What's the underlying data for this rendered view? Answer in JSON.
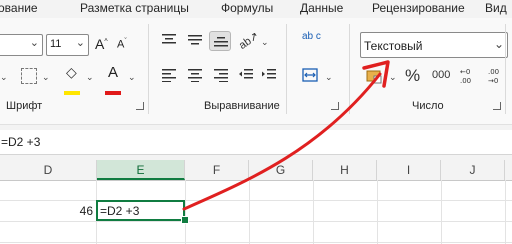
{
  "tabs": [
    "ование",
    "Разметка страницы",
    "Формулы",
    "Данные",
    "Рецензирование",
    "Вид"
  ],
  "ribbon": {
    "font_size": "11",
    "number_format": "Текстовый",
    "groups": {
      "font": "Шрифт",
      "alignment": "Выравнивание",
      "number": "Число"
    },
    "percent_symbol": "%",
    "comma_symbol": "000",
    "font_color_letter": "A",
    "wrap_icon_text": "ab c"
  },
  "formula_bar": {
    "content": "=D2 +3"
  },
  "columns": [
    "D",
    "E",
    "F",
    "G",
    "H",
    "I",
    "J"
  ],
  "selected_column": "E",
  "cells": {
    "d2": "46",
    "e2": "=D2 +3"
  },
  "colors": {
    "arrow": "#e02020",
    "excel_green": "#107c41",
    "font_color_bar": "#e11a1a",
    "fill_color_bar": "#ffe600"
  }
}
